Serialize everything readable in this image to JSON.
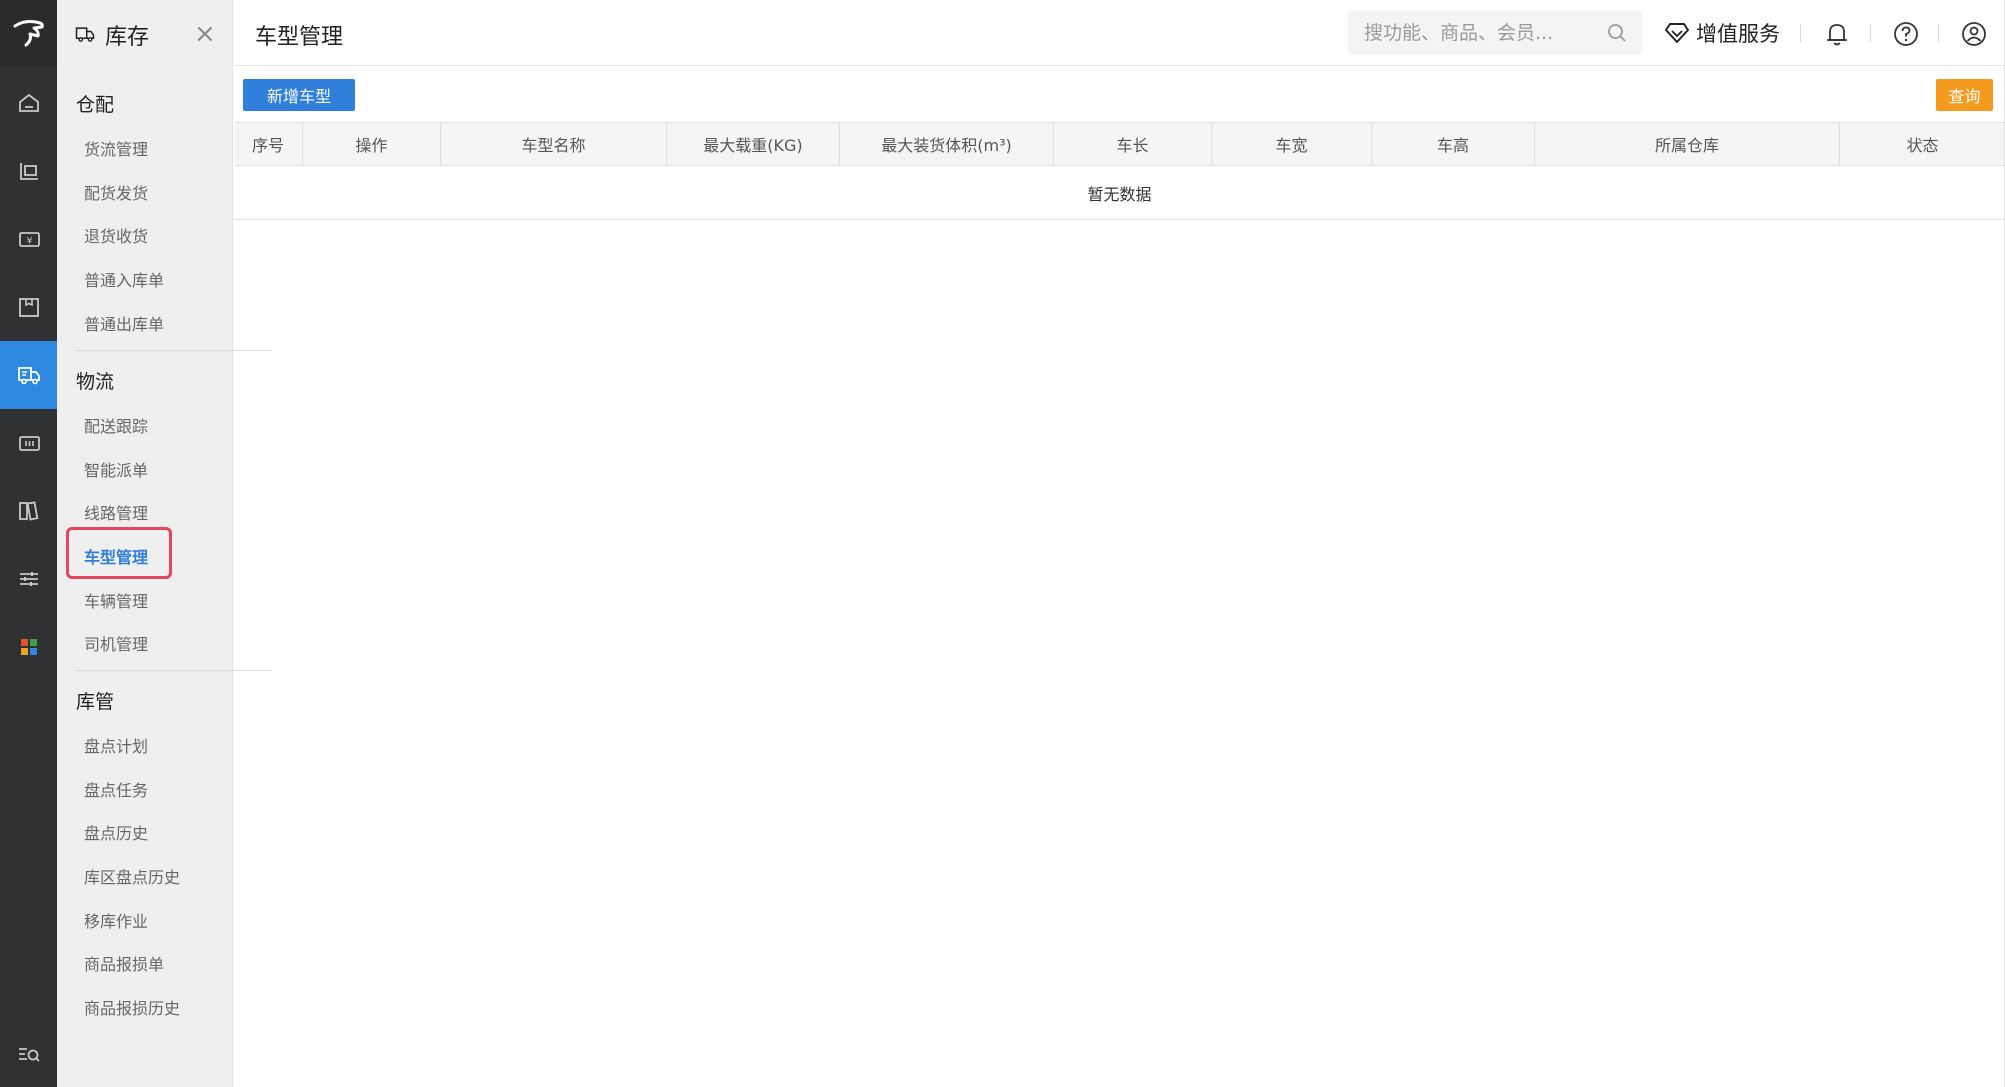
{
  "app": {
    "module_title": "库存",
    "close_symbol": "×"
  },
  "rail": {
    "items": [
      {
        "name": "home-icon"
      },
      {
        "name": "goods-icon"
      },
      {
        "name": "money-icon"
      },
      {
        "name": "warehouse-box-icon"
      },
      {
        "name": "truck-icon",
        "active": true
      },
      {
        "name": "ticket-icon"
      },
      {
        "name": "report-icon"
      },
      {
        "name": "settings-sliders-icon"
      },
      {
        "name": "apps-grid-icon"
      }
    ],
    "bottom": "search-menu-icon"
  },
  "submenu": {
    "groups": [
      {
        "title": "仓配",
        "items": [
          "货流管理",
          "配货发货",
          "退货收货",
          "普通入库单",
          "普通出库单"
        ]
      },
      {
        "title": "物流",
        "items": [
          "配送跟踪",
          "智能派单",
          "线路管理",
          "车型管理",
          "车辆管理",
          "司机管理"
        ]
      },
      {
        "title": "库管",
        "items": [
          "盘点计划",
          "盘点任务",
          "盘点历史",
          "库区盘点历史",
          "移库作业",
          "商品报损单",
          "商品报损历史"
        ]
      }
    ],
    "active_item": "车型管理"
  },
  "header": {
    "page_title": "车型管理",
    "search_placeholder": "搜功能、商品、会员...",
    "value_added_label": "增值服务"
  },
  "toolbar": {
    "add_label": "新增车型",
    "query_label": "查询"
  },
  "table": {
    "columns": [
      "序号",
      "操作",
      "车型名称",
      "最大载重(KG)",
      "最大装货体积(m³)",
      "车长",
      "车宽",
      "车高",
      "所属仓库",
      "状态"
    ],
    "empty_text": "暂无数据"
  },
  "colors": {
    "primary": "#2f7fdb",
    "query": "#f39a1f",
    "rail_bg": "#2f3133",
    "highlight": "#e64560"
  }
}
